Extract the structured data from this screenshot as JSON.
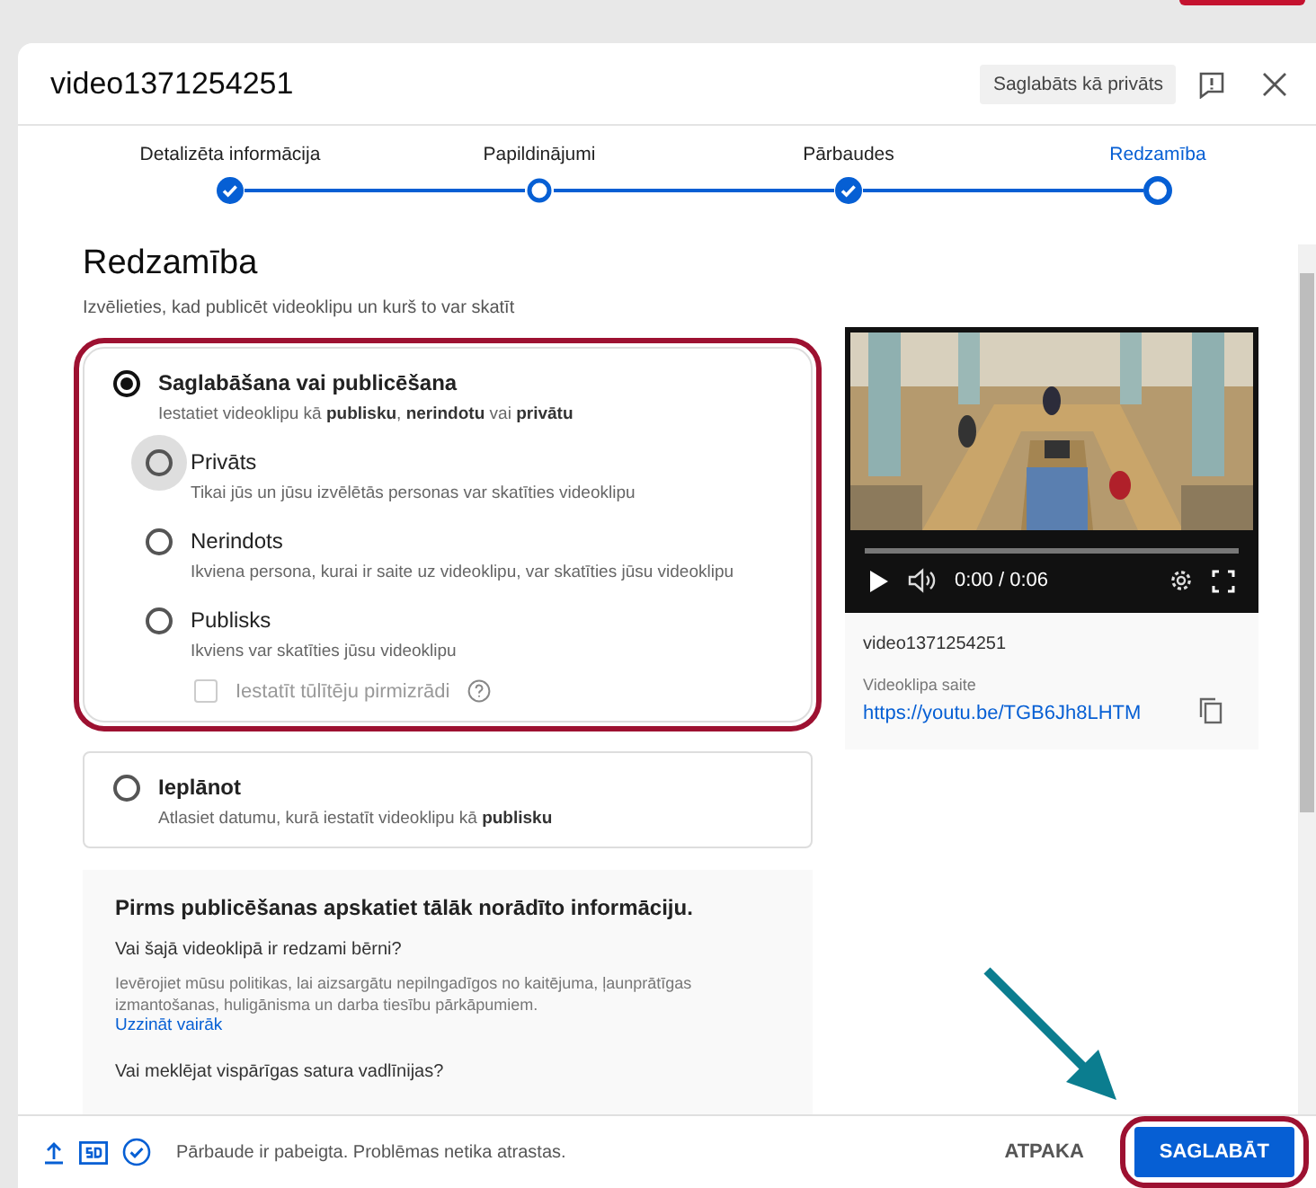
{
  "dialog": {
    "title": "video1371254251",
    "badge": "Saglabāts kā privāts"
  },
  "steps": [
    {
      "label": "Detalizēta informācija",
      "completed": true,
      "current": false
    },
    {
      "label": "Papildinājumi",
      "completed": false,
      "current": false
    },
    {
      "label": "Pārbaudes",
      "completed": true,
      "current": false
    },
    {
      "label": "Redzamība",
      "completed": false,
      "current": true
    }
  ],
  "visibility": {
    "heading": "Redzamība",
    "subtitle": "Izvēlieties, kad publicēt videoklipu un kurš to var skatīt"
  },
  "save_or_publish": {
    "label": "Saglabāšana vai publicēšana",
    "description": "Iestatiet videoklipu kā **publisku**, **nerindotu** vai **privātu**",
    "selected": true,
    "highlighted": true,
    "options": [
      {
        "label": "Privāts",
        "description": "Tikai jūs un jūsu izvēlētās personas var skatīties videoklipu",
        "selected": false,
        "focused": true
      },
      {
        "label": "Nerindots",
        "description": "Ikviena persona, kurai ir saite uz videoklipu, var skatīties jūsu videoklipu",
        "selected": false,
        "focused": false
      },
      {
        "label": "Publisks",
        "description": "Ikviens var skatīties jūsu videoklipu",
        "selected": false,
        "focused": false
      }
    ],
    "premiere": {
      "label": "Iestatīt tūlītēju pirmizrādi",
      "checked": false,
      "disabled": true
    }
  },
  "schedule": {
    "label": "Ieplānot",
    "description": "Atlasiet datumu, kurā iestatīt videoklipu kā **publisku**",
    "selected": false
  },
  "info": {
    "title": "Pirms publicēšanas apskatiet tālāk norādīto informāciju.",
    "question_1": "Vai šajā videoklipā ir redzami bērni?",
    "text_1": "Ievērojiet mūsu politikas, lai aizsargātu nepilngadīgos no kaitējuma, ļaunprātīgas izmantošanas, huligānisma un darba tiesību pārkāpumiem.",
    "link_1": "Uzzināt vairāk",
    "question_2": "Vai meklējat vispārīgas satura vadlīnijas?"
  },
  "video": {
    "time": "0:00 / 0:06",
    "level": 0,
    "filename": "video1371254251",
    "link_label": "Videoklipa saite",
    "link": "https://youtu.be/TGB6Jh8LHTM"
  },
  "footer": {
    "status": "Pārbaude ir pabeigta. Problēmas netika atrastas.",
    "back": "ATPAKA",
    "save": "SAGLABĀT",
    "save_highlighted": true
  },
  "arrow": true
}
